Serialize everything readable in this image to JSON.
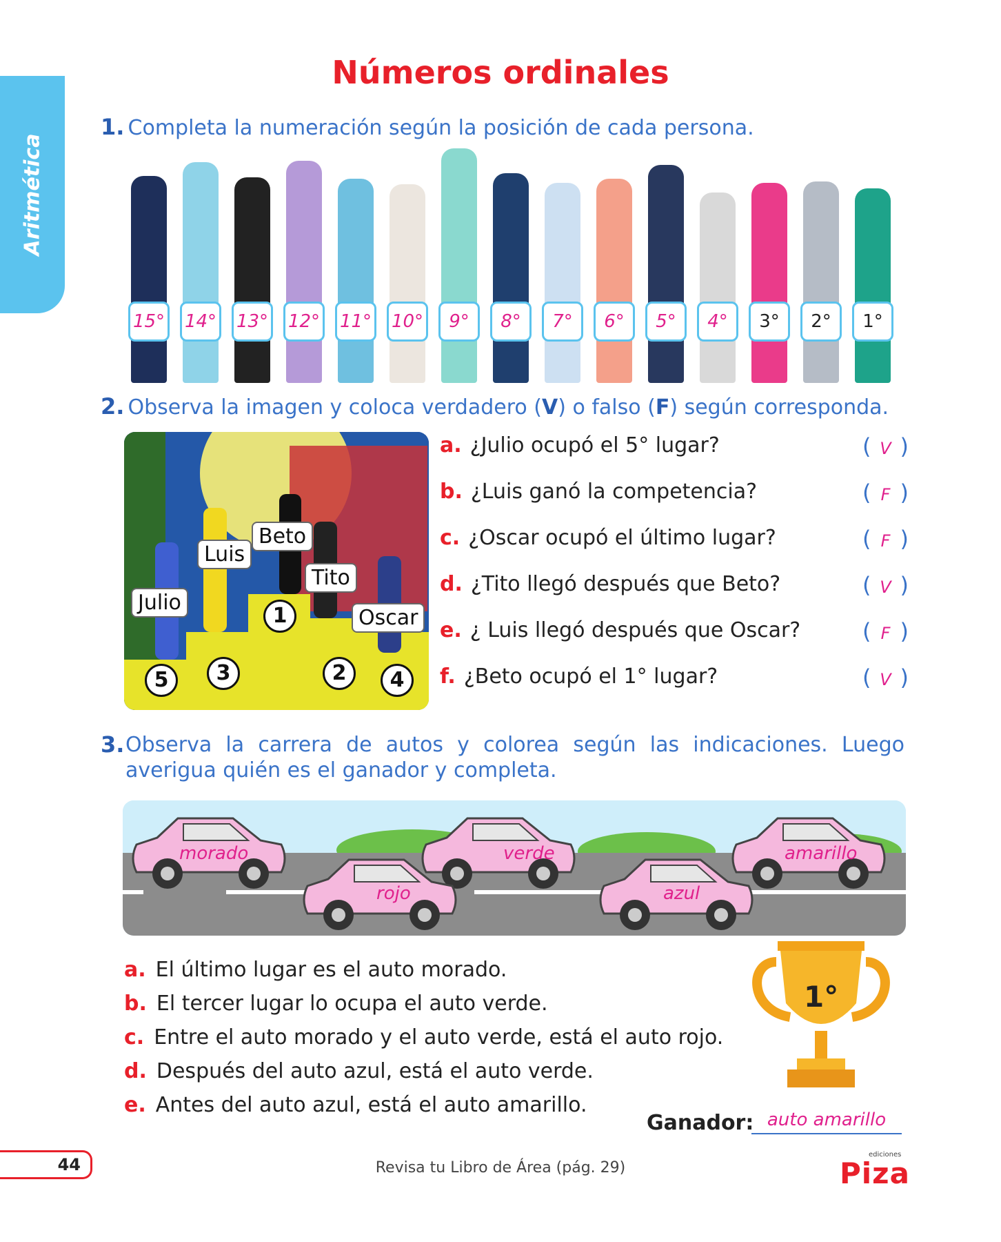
{
  "side_tab": "Aritmética",
  "title": "Números ordinales",
  "q1": {
    "num": "1.",
    "text": "Completa la numeración según la posición de cada persona."
  },
  "ordinal_boxes": [
    {
      "text": "15°",
      "style": "hand"
    },
    {
      "text": "14°",
      "style": "hand"
    },
    {
      "text": "13°",
      "style": "hand"
    },
    {
      "text": "12°",
      "style": "hand"
    },
    {
      "text": "11°",
      "style": "hand"
    },
    {
      "text": "10°",
      "style": "hand"
    },
    {
      "text": "9°",
      "style": "hand"
    },
    {
      "text": "8°",
      "style": "hand"
    },
    {
      "text": "7°",
      "style": "hand"
    },
    {
      "text": "6°",
      "style": "hand"
    },
    {
      "text": "5°",
      "style": "hand"
    },
    {
      "text": "4°",
      "style": "hand"
    },
    {
      "text": "3°",
      "style": "print"
    },
    {
      "text": "2°",
      "style": "print"
    },
    {
      "text": "1°",
      "style": "print"
    }
  ],
  "q2": {
    "num": "2.",
    "text_a": "Observa la imagen y coloca verdadero (",
    "v": "V",
    "text_b": ") o falso (",
    "f": "F",
    "text_c": ") según corresponda.",
    "names": [
      "Beto",
      "Luis",
      "Tito",
      "Julio",
      "Oscar"
    ],
    "podium_numbers": [
      "1",
      "3",
      "2",
      "5",
      "4"
    ],
    "items": [
      {
        "letter": "a.",
        "text": "¿Julio ocupó el 5° lugar?",
        "answer": "V"
      },
      {
        "letter": "b.",
        "text": "¿Luis ganó la competencia?",
        "answer": "F"
      },
      {
        "letter": "c.",
        "text": "¿Oscar ocupó el último lugar?",
        "answer": "F"
      },
      {
        "letter": "d.",
        "text": "¿Tito llegó después que Beto?",
        "answer": "V"
      },
      {
        "letter": "e.",
        "text": "¿ Luis llegó después que Oscar?",
        "answer": "F"
      },
      {
        "letter": "f.",
        "text": "¿Beto ocupó el 1° lugar?",
        "answer": "V"
      }
    ],
    "paren_open": "(",
    "paren_close": ")"
  },
  "q3": {
    "num": "3.",
    "text": "Observa la carrera de autos y colorea según las indicaciones. Luego averigua quién es el ganador y completa.",
    "car_labels": [
      "morado",
      "verde",
      "amarillo",
      "rojo",
      "azul"
    ],
    "indications": [
      {
        "letter": "a.",
        "text": "El último lugar es el auto morado."
      },
      {
        "letter": "b.",
        "text": "El tercer lugar lo ocupa el auto verde."
      },
      {
        "letter": "c.",
        "text": "Entre el auto morado y el auto verde, está el auto rojo."
      },
      {
        "letter": "d.",
        "text": "Después del auto azul, está el auto verde."
      },
      {
        "letter": "e.",
        "text": "Antes del auto azul, está el auto amarillo."
      }
    ],
    "trophy_text": "1°",
    "winner_label": "Ganador:",
    "winner_answer": "auto amarillo"
  },
  "footer": {
    "page_number": "44",
    "reference": "Revisa tu Libro de Área (pág. 29)",
    "logo_small": "ediciones",
    "logo": "Piza"
  },
  "colors": {
    "accent_red": "#e8202a",
    "blue_text": "#3a73c8",
    "tab_blue": "#5bc3ee",
    "answer_pink": "#e0208c",
    "car_pink": "#f5b8dd"
  }
}
